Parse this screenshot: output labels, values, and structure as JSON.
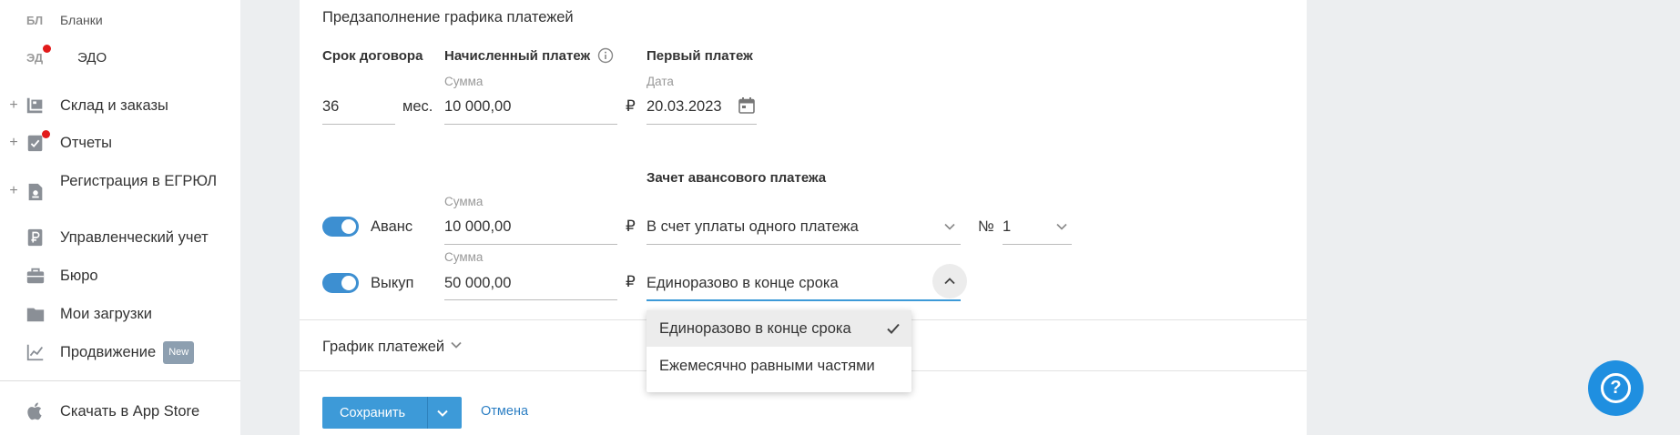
{
  "sidebar": {
    "items": [
      {
        "abbr": "БЛ",
        "label": "Бланки"
      },
      {
        "abbr": "ЭД",
        "label": "ЭДО"
      },
      {
        "label": "Склад и заказы",
        "icon": "warehouse-icon"
      },
      {
        "label": "Отчеты",
        "icon": "reports-icon"
      },
      {
        "label": "Регистрация в ЕГРЮЛ",
        "icon": "registration-icon"
      },
      {
        "label": "Управленческий учет",
        "icon": "ruble-doc-icon"
      },
      {
        "label": "Бюро",
        "icon": "briefcase-icon"
      },
      {
        "label": "Мои загрузки",
        "icon": "folder-icon"
      },
      {
        "label": "Продвижение",
        "badge": "New",
        "icon": "chart-icon"
      },
      {
        "label": "Скачать в App Store",
        "icon": "apple-icon"
      }
    ],
    "plus_symbol": "+"
  },
  "form": {
    "section_title": "Предзаполнение графика платежей",
    "term_label": "Срок договора",
    "term_value": "36",
    "term_unit": "мес.",
    "accrued_label": "Начисленный платеж",
    "sum_caption": "Сумма",
    "accrued_value": "10 000,00",
    "currency": "₽",
    "first_payment_label": "Первый платеж",
    "date_caption": "Дата",
    "first_payment_date": "20.03.2023",
    "advance_offset_label": "Зачет авансового платежа",
    "advance": {
      "label": "Аванс",
      "enabled": true,
      "sum_caption": "Сумма",
      "value": "10 000,00",
      "offset_select": "В счет уплаты одного платежа",
      "number_sign": "№",
      "number_value": "1"
    },
    "buyout": {
      "label": "Выкуп",
      "enabled": true,
      "sum_caption": "Сумма",
      "value": "50 000,00",
      "mode_select": "Единоразово в конце срока"
    },
    "dropdown_options": [
      {
        "label": "Единоразово в конце срока",
        "selected": true
      },
      {
        "label": "Ежемесячно равными частями",
        "selected": false
      }
    ],
    "schedule_label": "График платежей",
    "save_label": "Сохранить",
    "cancel_label": "Отмена"
  },
  "help": {
    "symbol": "?"
  },
  "colors": {
    "accent": "#3d9ad8",
    "toggle": "#3d8fd1",
    "notification": "#e21b1b",
    "help": "#1f8fe0",
    "link": "#2d7fc4"
  }
}
